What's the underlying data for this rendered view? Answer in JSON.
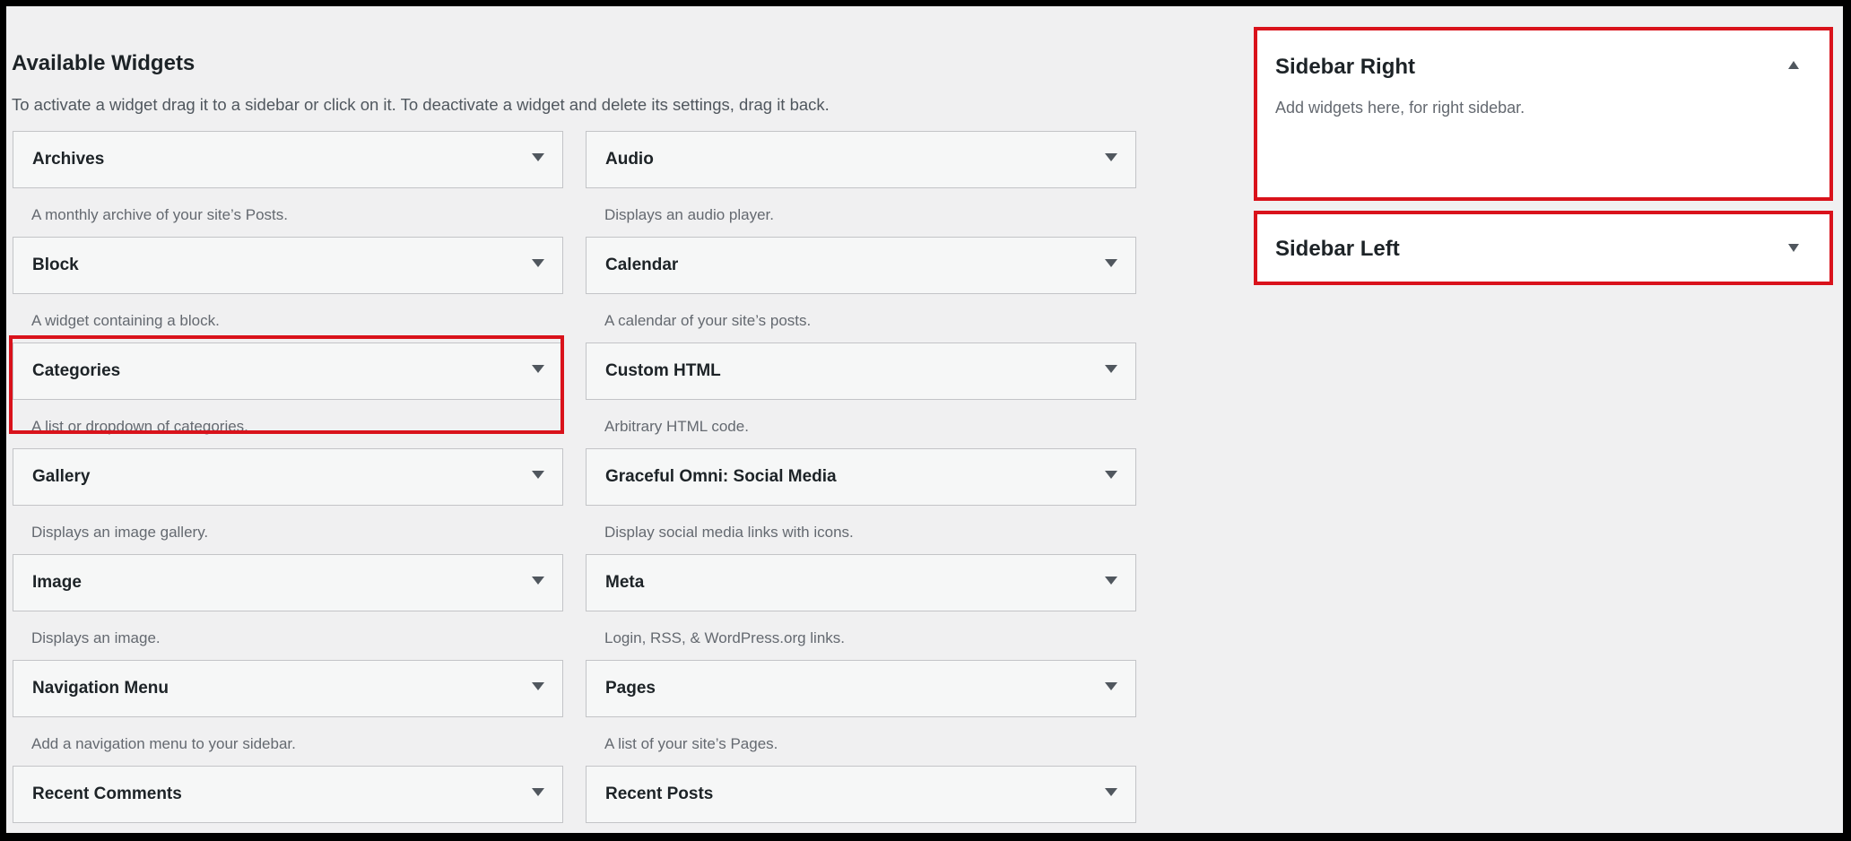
{
  "available": {
    "title": "Available Widgets",
    "description": "To activate a widget drag it to a sidebar or click on it. To deactivate a widget and delete its settings, drag it back."
  },
  "widgets_left": [
    {
      "name": "Archives",
      "desc": "A monthly archive of your site’s Posts."
    },
    {
      "name": "Block",
      "desc": "A widget containing a block."
    },
    {
      "name": "Categories",
      "desc": "A list or dropdown of categories."
    },
    {
      "name": "Gallery",
      "desc": "Displays an image gallery."
    },
    {
      "name": "Image",
      "desc": "Displays an image."
    },
    {
      "name": "Navigation Menu",
      "desc": "Add a navigation menu to your sidebar."
    },
    {
      "name": "Recent Comments",
      "desc": ""
    }
  ],
  "widgets_right": [
    {
      "name": "Audio",
      "desc": "Displays an audio player."
    },
    {
      "name": "Calendar",
      "desc": "A calendar of your site’s posts."
    },
    {
      "name": "Custom HTML",
      "desc": "Arbitrary HTML code."
    },
    {
      "name": "Graceful Omni: Social Media",
      "desc": "Display social media links with icons."
    },
    {
      "name": "Meta",
      "desc": "Login, RSS, & WordPress.org links."
    },
    {
      "name": "Pages",
      "desc": "A list of your site’s Pages."
    },
    {
      "name": "Recent Posts",
      "desc": ""
    }
  ],
  "sidebars": {
    "right": {
      "title": "Sidebar Right",
      "description": "Add widgets here, for right sidebar.",
      "expanded": true
    },
    "left": {
      "title": "Sidebar Left",
      "expanded": false
    }
  },
  "colors": {
    "highlight": "#d9121b",
    "background": "#f0f0f1",
    "widget_bg": "#f6f7f7",
    "border": "#c3c4c7"
  }
}
